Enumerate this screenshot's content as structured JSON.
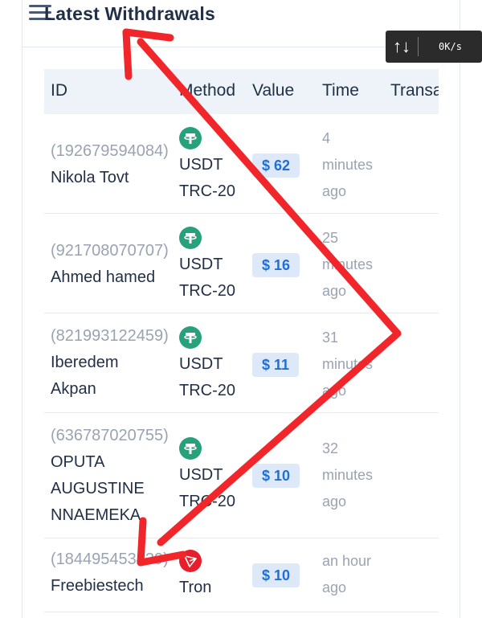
{
  "header": {
    "title": "Latest Withdrawals"
  },
  "speed_widget": {
    "arrows": "↑↓",
    "value": "0K/s"
  },
  "table": {
    "columns": [
      "ID",
      "Method",
      "Value",
      "Time",
      "Transa"
    ],
    "rows": [
      {
        "txid": "(192679594084)",
        "name": "Nikola Tovt",
        "coin": "usdt-icon",
        "method_l1": "USDT",
        "method_l2": "TRC-20",
        "value": "$ 62",
        "time_l1": "4",
        "time_l2": "minutes",
        "time_l3": "ago"
      },
      {
        "txid": "(921708070707)",
        "name": "Ahmed hamed",
        "coin": "usdt-icon",
        "method_l1": "USDT",
        "method_l2": "TRC-20",
        "value": "$ 16",
        "time_l1": "25",
        "time_l2": "minutes",
        "time_l3": "ago"
      },
      {
        "txid": "(821993122459)",
        "name_l1": "Iberedem",
        "name_l2": "Akpan",
        "coin": "usdt-icon",
        "method_l1": "USDT",
        "method_l2": "TRC-20",
        "value": "$ 11",
        "time_l1": "31",
        "time_l2": "minutes",
        "time_l3": "ago"
      },
      {
        "txid": "(636787020755)",
        "name_l1": "OPUTA",
        "name_l2": "AUGUSTINE",
        "name_l3": "NNAEMEKA",
        "coin": "usdt-icon",
        "method_l1": "USDT",
        "method_l2": "TRC-20",
        "value": "$ 10",
        "time_l1": "32",
        "time_l2": "minutes",
        "time_l3": "ago"
      },
      {
        "txid": "(184495453439)",
        "name": "Freebiestech",
        "coin": "tron-icon",
        "method_l1": "Tron",
        "value": "$ 10",
        "time_l1": "an hour",
        "time_l2": "ago"
      }
    ]
  },
  "colors": {
    "accent": "#1e6fd9",
    "usdt": "#26a17b",
    "tron": "#e5202c",
    "annotation": "#f0262b"
  }
}
